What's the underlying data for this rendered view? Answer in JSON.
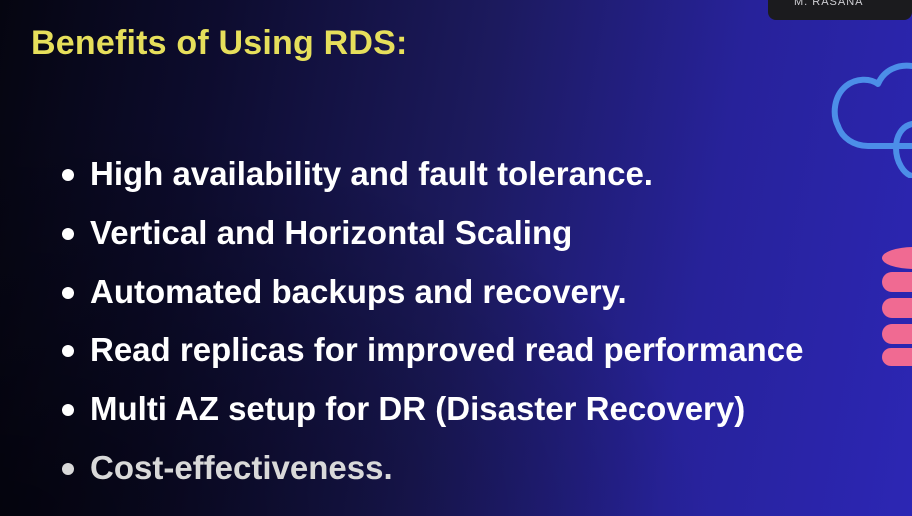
{
  "slide": {
    "title": "Benefits of Using RDS:",
    "bullets": [
      "High availability and fault tolerance.",
      "Vertical and Horizontal Scaling",
      "Automated backups and recovery.",
      "Read replicas for improved read performance",
      "Multi AZ setup for DR (Disaster Recovery)",
      "Cost-effectiveness."
    ]
  },
  "overlay": {
    "tab_text": "M. RASANA"
  },
  "decorations": {
    "cloud_icon": "cloud-icon",
    "database_icon": "database-icon"
  },
  "colors": {
    "title": "#e6df5b",
    "bullet_text": "#ffffff",
    "background_start": "#050510",
    "background_end": "#2c26b4",
    "cloud_outline": "#4c8ee8",
    "database": "#f06a92"
  }
}
